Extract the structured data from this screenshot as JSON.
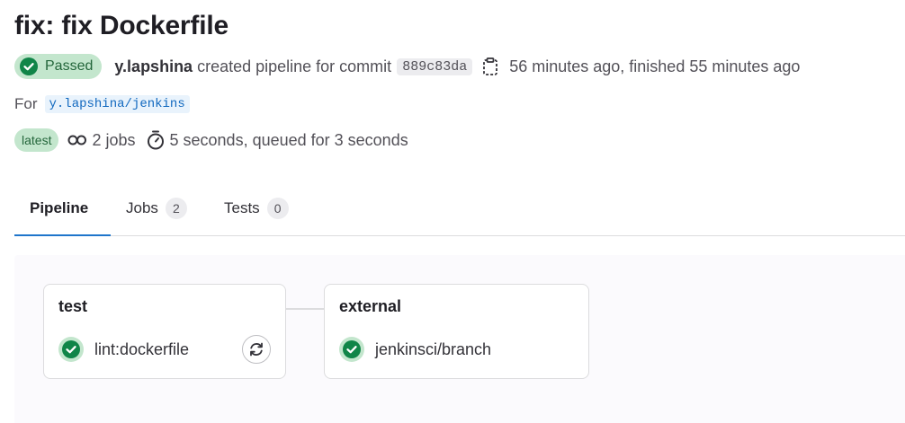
{
  "title": "fix: fix Dockerfile",
  "status": {
    "label": "Passed"
  },
  "author": "y.lapshina",
  "created_text": "created pipeline for commit",
  "commit_sha": "889c83da",
  "time_text": "56 minutes ago, finished 55 minutes ago",
  "project": {
    "prefix": "For",
    "name": "y.lapshina/jenkins"
  },
  "latest_badge": "latest",
  "jobs_count_text": "2 jobs",
  "duration_text": "5 seconds, queued for 3 seconds",
  "tabs": [
    {
      "label": "Pipeline",
      "count": null
    },
    {
      "label": "Jobs",
      "count": "2"
    },
    {
      "label": "Tests",
      "count": "0"
    }
  ],
  "stages": [
    {
      "title": "test",
      "job": "lint:dockerfile"
    },
    {
      "title": "external",
      "job": "jenkinsci/branch"
    }
  ],
  "colors": {
    "success": "#108548",
    "badge_bg": "#c3e6cd",
    "tab_active": "#1f75cb"
  }
}
